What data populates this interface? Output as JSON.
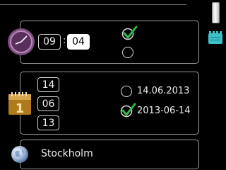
{
  "clock": {
    "hours": "09",
    "separator": ":",
    "minutes": "04",
    "format_24h_checked": true,
    "format_12h_checked": false
  },
  "date": {
    "day": "14",
    "month": "06",
    "year": "13",
    "format_options": [
      {
        "label": "14.06.2013",
        "checked": false
      },
      {
        "label": "2013-06-14",
        "checked": true
      }
    ],
    "calendar_icon_digit": "1"
  },
  "location": {
    "city": "Stockholm"
  },
  "colors": {
    "check_green": "#2fb84a",
    "clock_purple": "#8a5a8c"
  },
  "icons": {
    "clock": "clock-icon",
    "calendar": "calendar-icon",
    "globe": "globe-icon",
    "card": "card-icon"
  }
}
